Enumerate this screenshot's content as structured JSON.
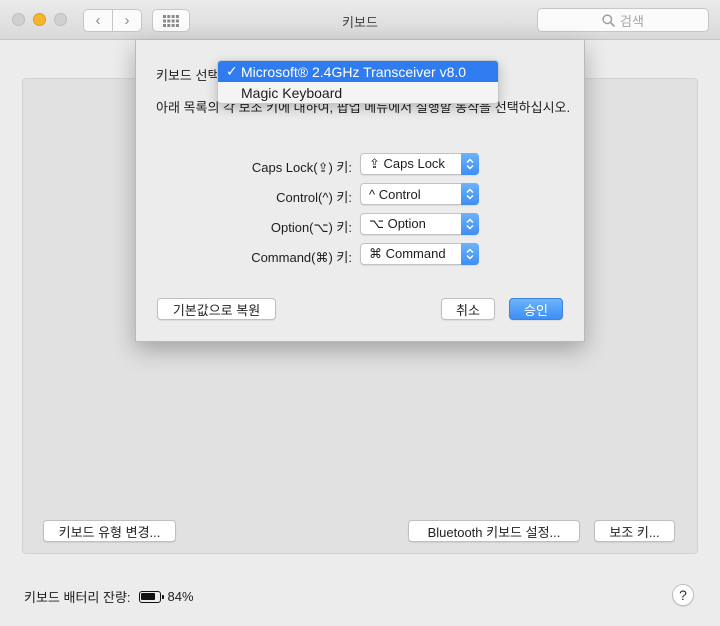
{
  "window": {
    "title": "키보드",
    "search_placeholder": "검색"
  },
  "nav": {
    "back_glyph": "‹",
    "forward_glyph": "›"
  },
  "sheet": {
    "select_label": "키보드 선택",
    "description": "아래 목록의 각 보조 키에 대하여, 팝업 메뉴에서 실행할 동작을 선택하십시오.",
    "rows": [
      {
        "label": "Caps Lock(⇪) 키:",
        "value": "⇪ Caps Lock"
      },
      {
        "label": "Control(^) 키:",
        "value": "^ Control"
      },
      {
        "label": "Option(⌥) 키:",
        "value": "⌥ Option"
      },
      {
        "label": "Command(⌘) 키:",
        "value": "⌘ Command"
      }
    ],
    "restore_button": "기본값으로 복원",
    "cancel_button": "취소",
    "ok_button": "승인"
  },
  "keyboard_menu": {
    "items": [
      {
        "label": "Microsoft® 2.4GHz Transceiver v8.0",
        "selected": true
      },
      {
        "label": "Magic Keyboard",
        "selected": false
      }
    ],
    "check_glyph": "✓"
  },
  "panel": {
    "change_type_button": "키보드 유형 변경...",
    "bluetooth_button": "Bluetooth 키보드 설정...",
    "modifier_button": "보조 키..."
  },
  "footer": {
    "battery_label": "키보드 배터리 잔량:",
    "battery_level": 84,
    "battery_text": "84%",
    "help_glyph": "?"
  },
  "colors": {
    "accent": "#3e8ef5",
    "menu_selected": "#2f7cf0",
    "minimize": "#f5b52e"
  },
  "icons": [
    "search-icon",
    "grid-icon",
    "chevron-left-icon",
    "chevron-right-icon",
    "checkmark-icon",
    "up-down-arrows-icon",
    "battery-icon",
    "help-icon"
  ]
}
